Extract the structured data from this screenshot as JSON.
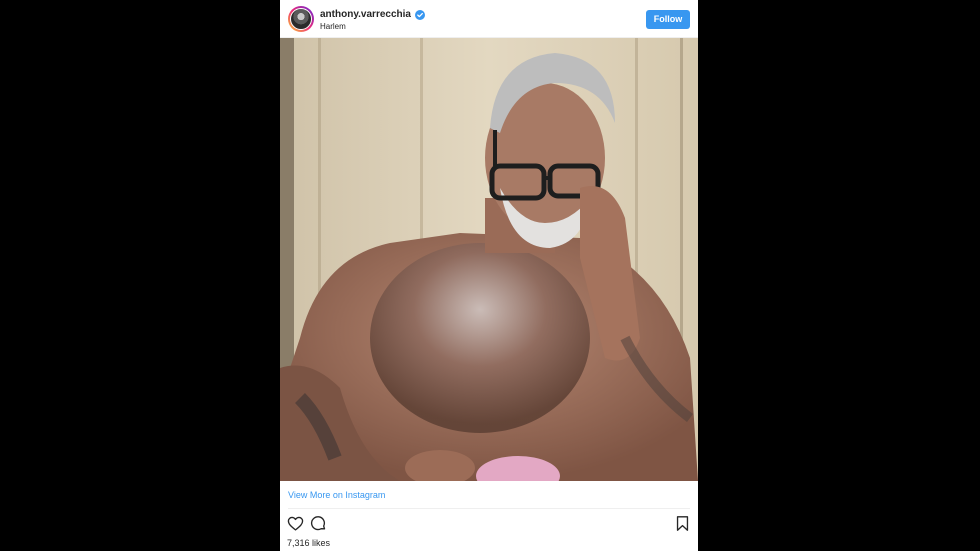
{
  "post": {
    "username": "anthony.varrecchia",
    "location": "Harlem",
    "follow_label": "Follow",
    "view_more_label": "View More on Instagram",
    "likes_text": "7,316 likes"
  },
  "icons": {
    "verified": "verified-badge-icon",
    "like": "heart-icon",
    "comment": "comment-icon",
    "save": "bookmark-icon"
  },
  "colors": {
    "accent": "#3897f0",
    "text": "#262626",
    "page_background": "#000000",
    "card_background": "#ffffff"
  }
}
